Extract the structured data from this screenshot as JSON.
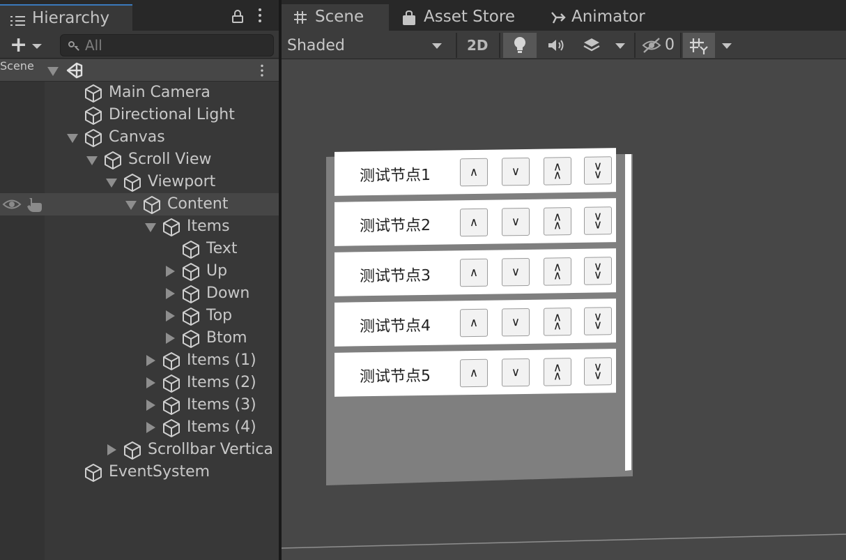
{
  "hierarchy": {
    "tab_label": "Hierarchy",
    "search": {
      "placeholder": "All"
    },
    "scene_label": "Scene",
    "nodes": {
      "main_camera": "Main Camera",
      "directional_light": "Directional Light",
      "canvas": "Canvas",
      "scroll_view": "Scroll View",
      "viewport": "Viewport",
      "content": "Content",
      "items": "Items",
      "text": "Text",
      "up": "Up",
      "down": "Down",
      "top": "Top",
      "btom": "Btom",
      "items_1": "Items (1)",
      "items_2": "Items (2)",
      "items_3": "Items (3)",
      "items_4": "Items (4)",
      "scrollbar_vertical": "Scrollbar Vertica",
      "event_system": "EventSystem"
    }
  },
  "scene_panel": {
    "tabs": [
      "Scene",
      "Asset Store",
      "Animator"
    ],
    "toolbar": {
      "draw_mode": "Shaded",
      "mode_2d": "2D",
      "hidden_count": "0"
    },
    "ui_rows": [
      {
        "label": "测试节点1"
      },
      {
        "label": "测试节点2"
      },
      {
        "label": "测试节点3"
      },
      {
        "label": "测试节点4"
      },
      {
        "label": "测试节点5"
      }
    ],
    "row_buttons": {
      "up": "∧",
      "down": "∨",
      "top": "∧\n∧",
      "bottom": "∨\n∨"
    }
  },
  "colors": {
    "panel_bg": "#383838",
    "scene_bg": "#474747",
    "tab_accent": "#3a79bb",
    "ui_item_bg": "#ffffff",
    "scroll_view_bg": "#808080"
  },
  "icons": [
    "hierarchy-list-icon",
    "lock-icon",
    "kebab-menu-icon",
    "plus-icon",
    "search-icon",
    "unity-logo-icon",
    "gameobject-cube-icon",
    "visibility-eye-icon",
    "pickable-hand-icon",
    "grid-icon",
    "bag-icon",
    "animator-icon",
    "lightbulb-icon",
    "audio-icon",
    "effects-icon",
    "hidden-eye-icon",
    "gizmos-icon"
  ]
}
